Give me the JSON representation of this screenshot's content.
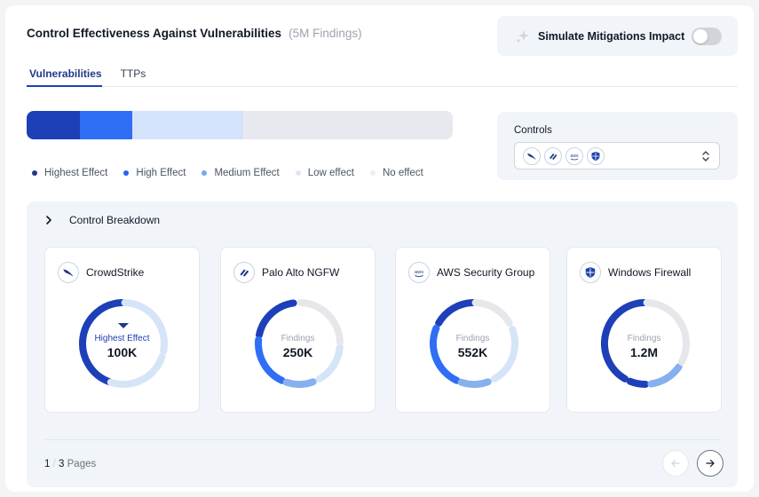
{
  "header": {
    "title": "Control Effectiveness Against Vulnerabilities",
    "subtitle": "(5M Findings)"
  },
  "simulate": {
    "label": "Simulate Mitigations Impact",
    "icon": "sparkle-icon",
    "enabled": false
  },
  "tabs": [
    {
      "label": "Vulnerabilities",
      "active": true
    },
    {
      "label": "TTPs",
      "active": false
    }
  ],
  "effect_bar": {
    "segments": [
      {
        "name": "Highest Effect",
        "fraction": 0.125,
        "color": "#1d3fb8"
      },
      {
        "name": "High Effect",
        "fraction": 0.123,
        "color": "#2f6ef5"
      },
      {
        "name": "Medium Effect",
        "fraction": 0.261,
        "color": "#d4e3fb"
      },
      {
        "name": "No effect",
        "fraction": 0.491,
        "color": "#e8e9ee"
      }
    ]
  },
  "legend": [
    {
      "label": "Highest Effect",
      "color": "#1e3a8a"
    },
    {
      "label": "High Effect",
      "color": "#2563eb"
    },
    {
      "label": "Medium Effect",
      "color": "#7aa6ea"
    },
    {
      "label": "Low effect",
      "color": "#dbe7f7"
    },
    {
      "label": "No effect",
      "color": "#eceef2"
    }
  ],
  "controls": {
    "label": "Controls",
    "selected_icons": [
      "crowdstrike-icon",
      "palo-alto-icon",
      "aws-icon",
      "windows-shield-icon"
    ],
    "aws_text": "aws"
  },
  "breakdown": {
    "title": "Control Breakdown",
    "cards": [
      {
        "name": "CrowdStrike",
        "icon": "crowdstrike-icon",
        "caption": "Highest Effect",
        "value": "100K",
        "hover": true
      },
      {
        "name": "Palo Alto NGFW",
        "icon": "palo-alto-icon",
        "caption": "Findings",
        "value": "250K",
        "hover": false
      },
      {
        "name": "AWS Security Group",
        "icon": "aws-icon",
        "caption": "Findings",
        "value": "552K",
        "hover": false
      },
      {
        "name": "Windows Firewall",
        "icon": "windows-shield-icon",
        "caption": "Findings",
        "value": "1.2M",
        "hover": false
      }
    ],
    "pager": {
      "current": "1",
      "sep": "/",
      "total": "3",
      "suffix": "Pages"
    }
  },
  "colors": {
    "highest": "#1d3fb8",
    "high": "#2f6ef5",
    "medium": "#86b0ef",
    "low": "#d6e4f8",
    "none": "#e5e7eb"
  }
}
